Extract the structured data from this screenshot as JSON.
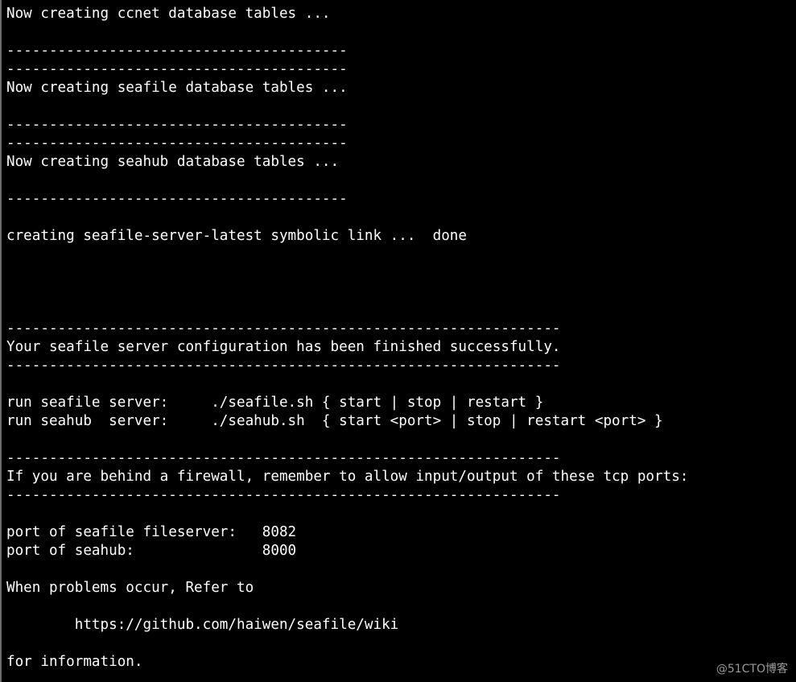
{
  "terminal": {
    "lines": [
      "Now creating ccnet database tables ...",
      "",
      "----------------------------------------",
      "----------------------------------------",
      "Now creating seafile database tables ...",
      "",
      "----------------------------------------",
      "----------------------------------------",
      "Now creating seahub database tables ...",
      "",
      "----------------------------------------",
      "",
      "creating seafile-server-latest symbolic link ...  done",
      "",
      "",
      "",
      "",
      "-----------------------------------------------------------------",
      "Your seafile server configuration has been finished successfully.",
      "-----------------------------------------------------------------",
      "",
      "run seafile server:     ./seafile.sh { start | stop | restart }",
      "run seahub  server:     ./seahub.sh  { start <port> | stop | restart <port> }",
      "",
      "-----------------------------------------------------------------",
      "If you are behind a firewall, remember to allow input/output of these tcp ports:",
      "-----------------------------------------------------------------",
      "",
      "port of seafile fileserver:   8082",
      "port of seahub:               8000",
      "",
      "When problems occur, Refer to",
      "",
      "        https://github.com/haiwen/seafile/wiki",
      "",
      "for information."
    ]
  },
  "watermark": {
    "text": "@51CTO博客"
  }
}
